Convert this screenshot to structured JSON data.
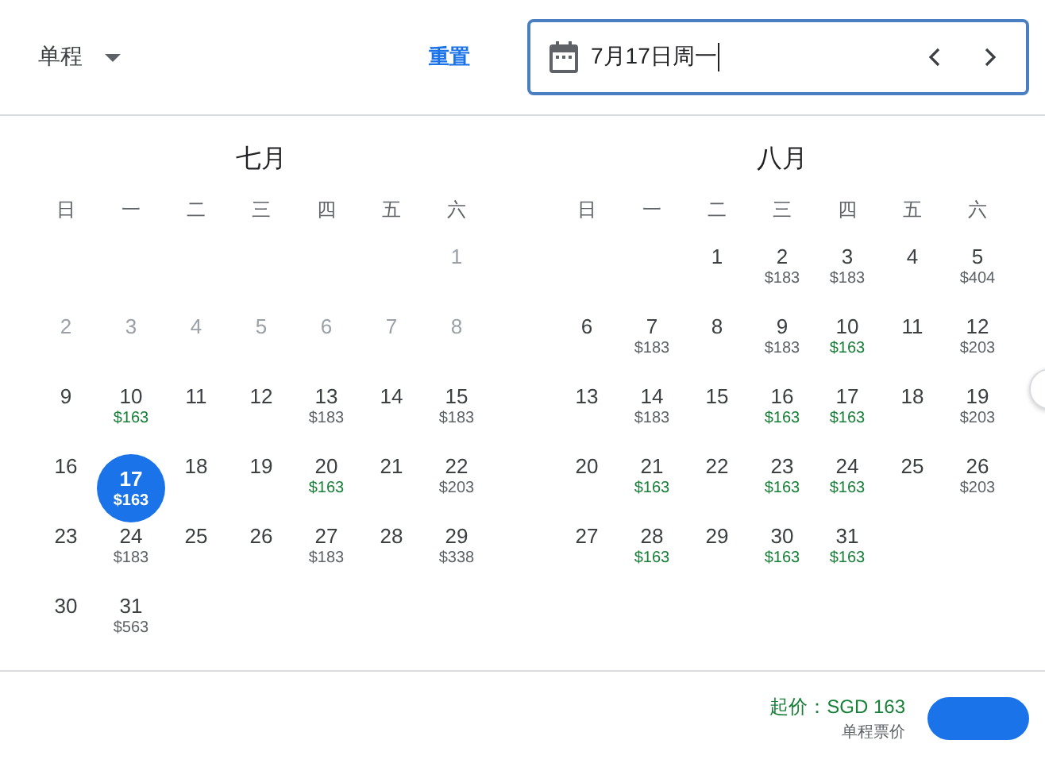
{
  "trip_type": {
    "label": "单程"
  },
  "reset": {
    "label": "重置"
  },
  "date_field": {
    "value": "7月17日周一"
  },
  "months": [
    {
      "title": "七月",
      "weekdays": [
        "日",
        "一",
        "二",
        "三",
        "四",
        "五",
        "六"
      ],
      "weeks": [
        [
          {
            "day": "1",
            "disabled": true,
            "selected": false
          }
        ],
        [
          {
            "day": "2",
            "disabled": true,
            "selected": false
          },
          {
            "day": "3",
            "disabled": true,
            "selected": false
          },
          {
            "day": "4",
            "disabled": true,
            "selected": false
          },
          {
            "day": "5",
            "disabled": true,
            "selected": false
          },
          {
            "day": "6",
            "disabled": true,
            "selected": false
          },
          {
            "day": "7",
            "disabled": true,
            "selected": false
          },
          {
            "day": "8",
            "disabled": true,
            "selected": false
          }
        ],
        [
          {
            "day": "9",
            "disabled": false,
            "selected": false
          },
          {
            "day": "10",
            "price": "$163",
            "low": true,
            "disabled": false,
            "selected": false
          },
          {
            "day": "11",
            "disabled": false,
            "selected": false
          },
          {
            "day": "12",
            "disabled": false,
            "selected": false
          },
          {
            "day": "13",
            "price": "$183",
            "low": false,
            "disabled": false,
            "selected": false
          },
          {
            "day": "14",
            "disabled": false,
            "selected": false
          },
          {
            "day": "15",
            "price": "$183",
            "low": false,
            "disabled": false,
            "selected": false
          }
        ],
        [
          {
            "day": "16",
            "disabled": false,
            "selected": false
          },
          {
            "day": "17",
            "price": "$163",
            "low": true,
            "disabled": false,
            "selected": true
          },
          {
            "day": "18",
            "disabled": false,
            "selected": false
          },
          {
            "day": "19",
            "disabled": false,
            "selected": false
          },
          {
            "day": "20",
            "price": "$163",
            "low": true,
            "disabled": false,
            "selected": false
          },
          {
            "day": "21",
            "disabled": false,
            "selected": false
          },
          {
            "day": "22",
            "price": "$203",
            "low": false,
            "disabled": false,
            "selected": false
          }
        ],
        [
          {
            "day": "23",
            "disabled": false,
            "selected": false
          },
          {
            "day": "24",
            "price": "$183",
            "low": false,
            "disabled": false,
            "selected": false
          },
          {
            "day": "25",
            "disabled": false,
            "selected": false
          },
          {
            "day": "26",
            "disabled": false,
            "selected": false
          },
          {
            "day": "27",
            "price": "$183",
            "low": false,
            "disabled": false,
            "selected": false
          },
          {
            "day": "28",
            "disabled": false,
            "selected": false
          },
          {
            "day": "29",
            "price": "$338",
            "low": false,
            "disabled": false,
            "selected": false
          }
        ],
        [
          {
            "day": "30",
            "disabled": false,
            "selected": false
          },
          {
            "day": "31",
            "price": "$563",
            "low": false,
            "disabled": false,
            "selected": false
          }
        ]
      ]
    },
    {
      "title": "八月",
      "weekdays": [
        "日",
        "一",
        "二",
        "三",
        "四",
        "五",
        "六"
      ],
      "weeks": [
        [
          {
            "day": "1",
            "disabled": false,
            "selected": false
          },
          {
            "day": "2",
            "price": "$183",
            "low": false,
            "disabled": false,
            "selected": false
          },
          {
            "day": "3",
            "price": "$183",
            "low": false,
            "disabled": false,
            "selected": false
          },
          {
            "day": "4",
            "disabled": false,
            "selected": false
          },
          {
            "day": "5",
            "price": "$404",
            "low": false,
            "disabled": false,
            "selected": false
          }
        ],
        [
          {
            "day": "6",
            "disabled": false,
            "selected": false
          },
          {
            "day": "7",
            "price": "$183",
            "low": false,
            "disabled": false,
            "selected": false
          },
          {
            "day": "8",
            "disabled": false,
            "selected": false
          },
          {
            "day": "9",
            "price": "$183",
            "low": false,
            "disabled": false,
            "selected": false
          },
          {
            "day": "10",
            "price": "$163",
            "low": true,
            "disabled": false,
            "selected": false
          },
          {
            "day": "11",
            "disabled": false,
            "selected": false
          },
          {
            "day": "12",
            "price": "$203",
            "low": false,
            "disabled": false,
            "selected": false
          }
        ],
        [
          {
            "day": "13",
            "disabled": false,
            "selected": false
          },
          {
            "day": "14",
            "price": "$183",
            "low": false,
            "disabled": false,
            "selected": false
          },
          {
            "day": "15",
            "disabled": false,
            "selected": false
          },
          {
            "day": "16",
            "price": "$163",
            "low": true,
            "disabled": false,
            "selected": false
          },
          {
            "day": "17",
            "price": "$163",
            "low": true,
            "disabled": false,
            "selected": false
          },
          {
            "day": "18",
            "disabled": false,
            "selected": false
          },
          {
            "day": "19",
            "price": "$203",
            "low": false,
            "disabled": false,
            "selected": false
          }
        ],
        [
          {
            "day": "20",
            "disabled": false,
            "selected": false
          },
          {
            "day": "21",
            "price": "$163",
            "low": true,
            "disabled": false,
            "selected": false
          },
          {
            "day": "22",
            "disabled": false,
            "selected": false
          },
          {
            "day": "23",
            "price": "$163",
            "low": true,
            "disabled": false,
            "selected": false
          },
          {
            "day": "24",
            "price": "$163",
            "low": true,
            "disabled": false,
            "selected": false
          },
          {
            "day": "25",
            "disabled": false,
            "selected": false
          },
          {
            "day": "26",
            "price": "$203",
            "low": false,
            "disabled": false,
            "selected": false
          }
        ],
        [
          {
            "day": "27",
            "disabled": false,
            "selected": false
          },
          {
            "day": "28",
            "price": "$163",
            "low": true,
            "disabled": false,
            "selected": false
          },
          {
            "day": "29",
            "disabled": false,
            "selected": false
          },
          {
            "day": "30",
            "price": "$163",
            "low": true,
            "disabled": false,
            "selected": false
          },
          {
            "day": "31",
            "price": "$163",
            "low": true,
            "disabled": false,
            "selected": false
          }
        ]
      ]
    }
  ],
  "footer": {
    "price": "起价：SGD 163",
    "note": "单程票价"
  }
}
